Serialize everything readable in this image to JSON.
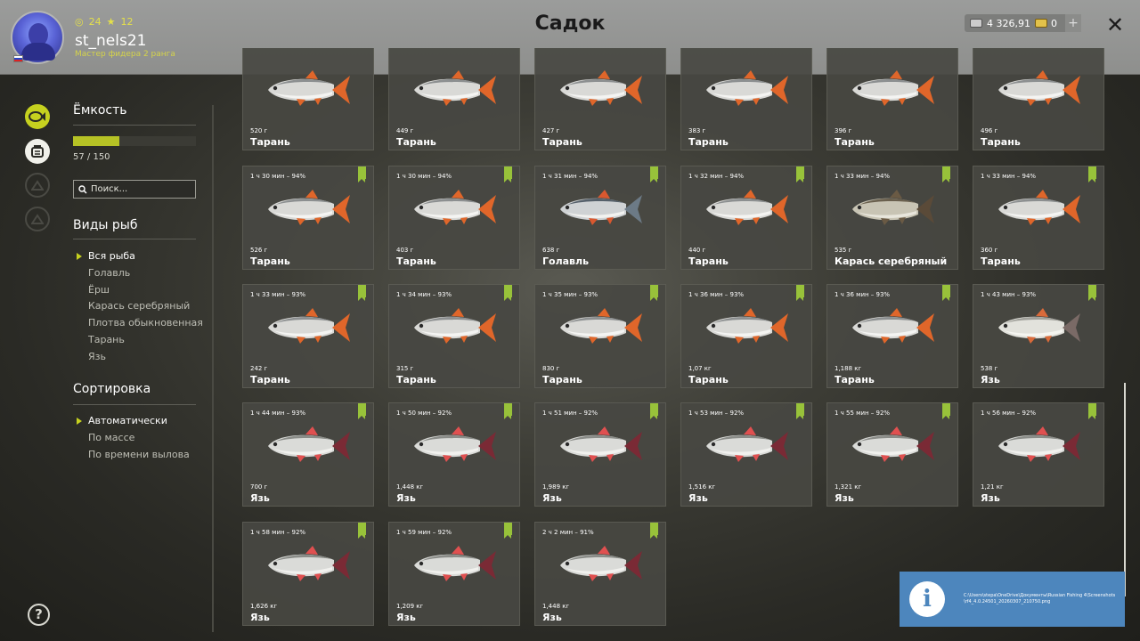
{
  "header": {
    "title": "Садок",
    "username": "st_nels21",
    "rank": "Мастер фидера 2 ранга",
    "stat_a": "24",
    "stat_b": "12",
    "money": "4 326,91",
    "gold": "0",
    "plus": "+",
    "close": "✕"
  },
  "capacity": {
    "title": "Ёмкость",
    "current": 57,
    "max": 150,
    "fill_fraction": 0.38,
    "text": "57 / 150"
  },
  "search": {
    "placeholder": "Поиск..."
  },
  "species": {
    "title": "Виды рыб",
    "items": [
      "Вся рыба",
      "Голавль",
      "Ёрш",
      "Карась серебряный",
      "Плотва обыкновенная",
      "Тарань",
      "Язь"
    ],
    "selected": 0
  },
  "sorting": {
    "title": "Сортировка",
    "items": [
      "Автоматически",
      "По массе",
      "По времени вылова"
    ],
    "selected": 0
  },
  "help": "?",
  "toast": {
    "icon": "i",
    "path": "C:\\Users\\stepa\\OneDrive\\Документы\\Russian Fishing 4\\Screenshots\\rf4_4.0.24501_20260307_210750.png"
  },
  "colors": {
    "accent": "#c6d11f",
    "mark": "#98c23a",
    "toast": "#4d86bd"
  },
  "fish": [
    {
      "time": "",
      "weight": "520 г",
      "name": "Тарань",
      "kind": "taran",
      "mark": false
    },
    {
      "time": "",
      "weight": "449 г",
      "name": "Тарань",
      "kind": "taran",
      "mark": false
    },
    {
      "time": "",
      "weight": "427 г",
      "name": "Тарань",
      "kind": "taran",
      "mark": false
    },
    {
      "time": "",
      "weight": "383 г",
      "name": "Тарань",
      "kind": "taran",
      "mark": false
    },
    {
      "time": "",
      "weight": "396 г",
      "name": "Тарань",
      "kind": "taran",
      "mark": false
    },
    {
      "time": "",
      "weight": "496 г",
      "name": "Тарань",
      "kind": "taran",
      "mark": false
    },
    {
      "time": "1 ч 30 мин – 94%",
      "weight": "526 г",
      "name": "Тарань",
      "kind": "taran",
      "mark": true
    },
    {
      "time": "1 ч 30 мин – 94%",
      "weight": "403 г",
      "name": "Тарань",
      "kind": "taran",
      "mark": true
    },
    {
      "time": "1 ч 31 мин – 94%",
      "weight": "638 г",
      "name": "Голавль",
      "kind": "golavl",
      "mark": true
    },
    {
      "time": "1 ч 32 мин – 94%",
      "weight": "440 г",
      "name": "Тарань",
      "kind": "taran",
      "mark": true
    },
    {
      "time": "1 ч 33 мин – 94%",
      "weight": "535 г",
      "name": "Карась серебряный",
      "kind": "karas",
      "mark": true
    },
    {
      "time": "1 ч 33 мин – 94%",
      "weight": "360 г",
      "name": "Тарань",
      "kind": "taran",
      "mark": true
    },
    {
      "time": "1 ч 33 мин – 93%",
      "weight": "242 г",
      "name": "Тарань",
      "kind": "taran",
      "mark": true
    },
    {
      "time": "1 ч 34 мин – 93%",
      "weight": "315 г",
      "name": "Тарань",
      "kind": "taran",
      "mark": true
    },
    {
      "time": "1 ч 35 мин – 93%",
      "weight": "830 г",
      "name": "Тарань",
      "kind": "taran",
      "mark": true
    },
    {
      "time": "1 ч 36 мин – 93%",
      "weight": "1,07 кг",
      "name": "Тарань",
      "kind": "taran",
      "mark": true
    },
    {
      "time": "1 ч 36 мин – 93%",
      "weight": "1,188 кг",
      "name": "Тарань",
      "kind": "taran",
      "mark": true
    },
    {
      "time": "1 ч 43 мин – 93%",
      "weight": "538 г",
      "name": "Язь",
      "kind": "yaz_light",
      "mark": true
    },
    {
      "time": "1 ч 44 мин – 93%",
      "weight": "700 г",
      "name": "Язь",
      "kind": "yaz",
      "mark": true
    },
    {
      "time": "1 ч 50 мин – 92%",
      "weight": "1,448 кг",
      "name": "Язь",
      "kind": "yaz",
      "mark": true
    },
    {
      "time": "1 ч 51 мин – 92%",
      "weight": "1,989 кг",
      "name": "Язь",
      "kind": "yaz",
      "mark": true
    },
    {
      "time": "1 ч 53 мин – 92%",
      "weight": "1,516 кг",
      "name": "Язь",
      "kind": "yaz",
      "mark": true
    },
    {
      "time": "1 ч 55 мин – 92%",
      "weight": "1,321 кг",
      "name": "Язь",
      "kind": "yaz",
      "mark": true
    },
    {
      "time": "1 ч 56 мин – 92%",
      "weight": "1,21 кг",
      "name": "Язь",
      "kind": "yaz",
      "mark": true
    },
    {
      "time": "1 ч 58 мин – 92%",
      "weight": "1,626 кг",
      "name": "Язь",
      "kind": "yaz",
      "mark": true
    },
    {
      "time": "1 ч 59 мин – 92%",
      "weight": "1,209 кг",
      "name": "Язь",
      "kind": "yaz",
      "mark": true
    },
    {
      "time": "2 ч 2 мин – 91%",
      "weight": "1,448 кг",
      "name": "Язь",
      "kind": "yaz",
      "mark": true
    }
  ]
}
